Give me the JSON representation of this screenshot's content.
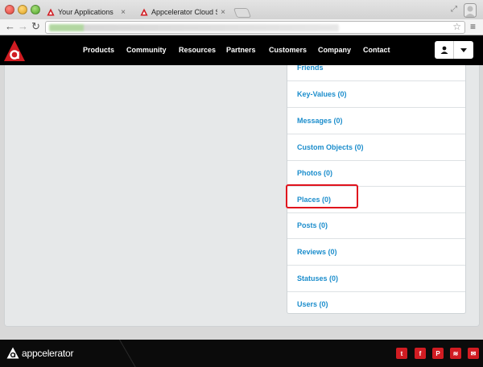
{
  "browser": {
    "tabs": [
      {
        "title": "Your Applications",
        "active": false
      },
      {
        "title": "Appcelerator Cloud Service",
        "active": true
      }
    ],
    "close_glyph": "×"
  },
  "nav": {
    "links": [
      "Products",
      "Community",
      "Resources",
      "Partners",
      "Customers",
      "Company",
      "Contact"
    ]
  },
  "panel": {
    "items": [
      "Friends",
      "Key-Values (0)",
      "Messages (0)",
      "Custom Objects (0)",
      "Photos (0)",
      "Places (0)",
      "Posts (0)",
      "Reviews (0)",
      "Statuses (0)",
      "Users (0)"
    ],
    "highlighted_index": 5
  },
  "footer": {
    "brand": "appcelerator",
    "social": [
      {
        "icon": "twitter-icon",
        "glyph": "t"
      },
      {
        "icon": "facebook-icon",
        "glyph": "f"
      },
      {
        "icon": "pinterest-icon",
        "glyph": "P"
      },
      {
        "icon": "rss-icon",
        "glyph": "≋"
      },
      {
        "icon": "email-icon",
        "glyph": "✉"
      }
    ]
  },
  "colors": {
    "brand_red": "#d11c22",
    "link_blue": "#1b8dcc",
    "highlight_red": "#e0131d",
    "nav_bg": "#000000"
  }
}
